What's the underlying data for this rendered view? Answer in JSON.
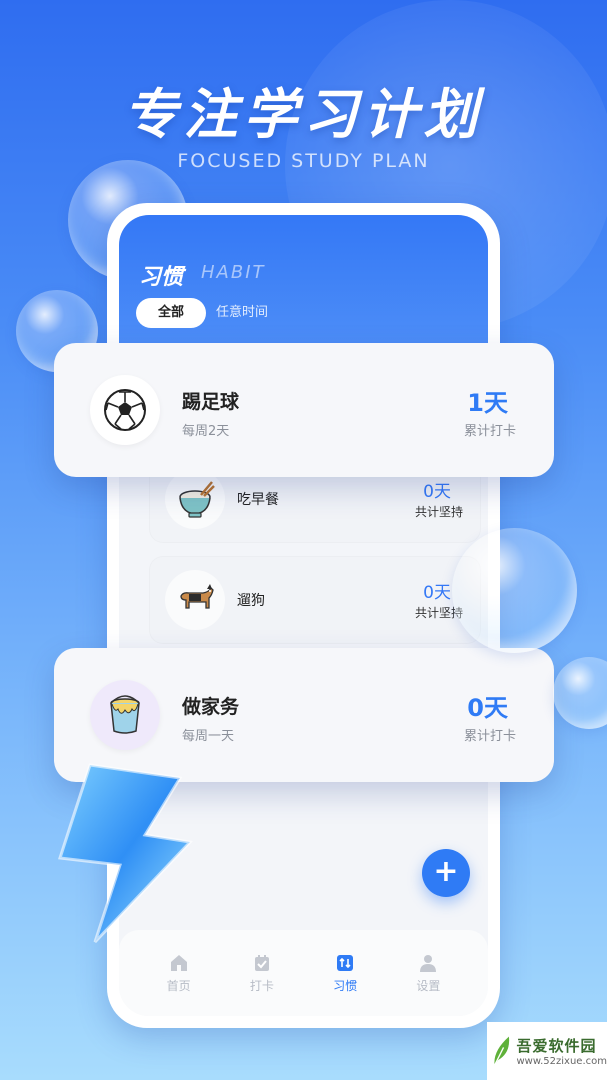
{
  "hero": {
    "title": "专注学习计划",
    "subtitle": "FOCUSED STUDY PLAN"
  },
  "header": {
    "title": "习惯",
    "subtitle": "HABIT",
    "tabs": [
      {
        "label": "全部",
        "active": true
      },
      {
        "label": "任意时间",
        "active": false
      }
    ]
  },
  "habits_inner": [
    {
      "name": "吃早餐",
      "count": "0天",
      "label": "共计坚持",
      "icon": "rice-bowl-icon"
    },
    {
      "name": "遛狗",
      "count": "0天",
      "label": "共计坚持",
      "icon": "dog-icon"
    }
  ],
  "habits_floating": [
    {
      "name": "踢足球",
      "frequency": "每周2天",
      "count": "1天",
      "label": "累计打卡",
      "icon": "soccer-ball-icon"
    },
    {
      "name": "做家务",
      "frequency": "每周一天",
      "count": "0天",
      "label": "累计打卡",
      "icon": "paint-bucket-icon"
    }
  ],
  "fab": {
    "label": "+"
  },
  "bottom_nav": [
    {
      "label": "首页",
      "icon": "home-icon",
      "active": false
    },
    {
      "label": "打卡",
      "icon": "checkin-icon",
      "active": false
    },
    {
      "label": "习惯",
      "icon": "habit-icon",
      "active": true
    },
    {
      "label": "设置",
      "icon": "settings-icon",
      "active": false
    }
  ],
  "watermark": {
    "name": "吾爱软件园",
    "url": "www.52zixue.com"
  },
  "colors": {
    "accent": "#2f7bf5",
    "header_blue": "#3478f6",
    "inactive_nav": "#b7bcc6"
  }
}
